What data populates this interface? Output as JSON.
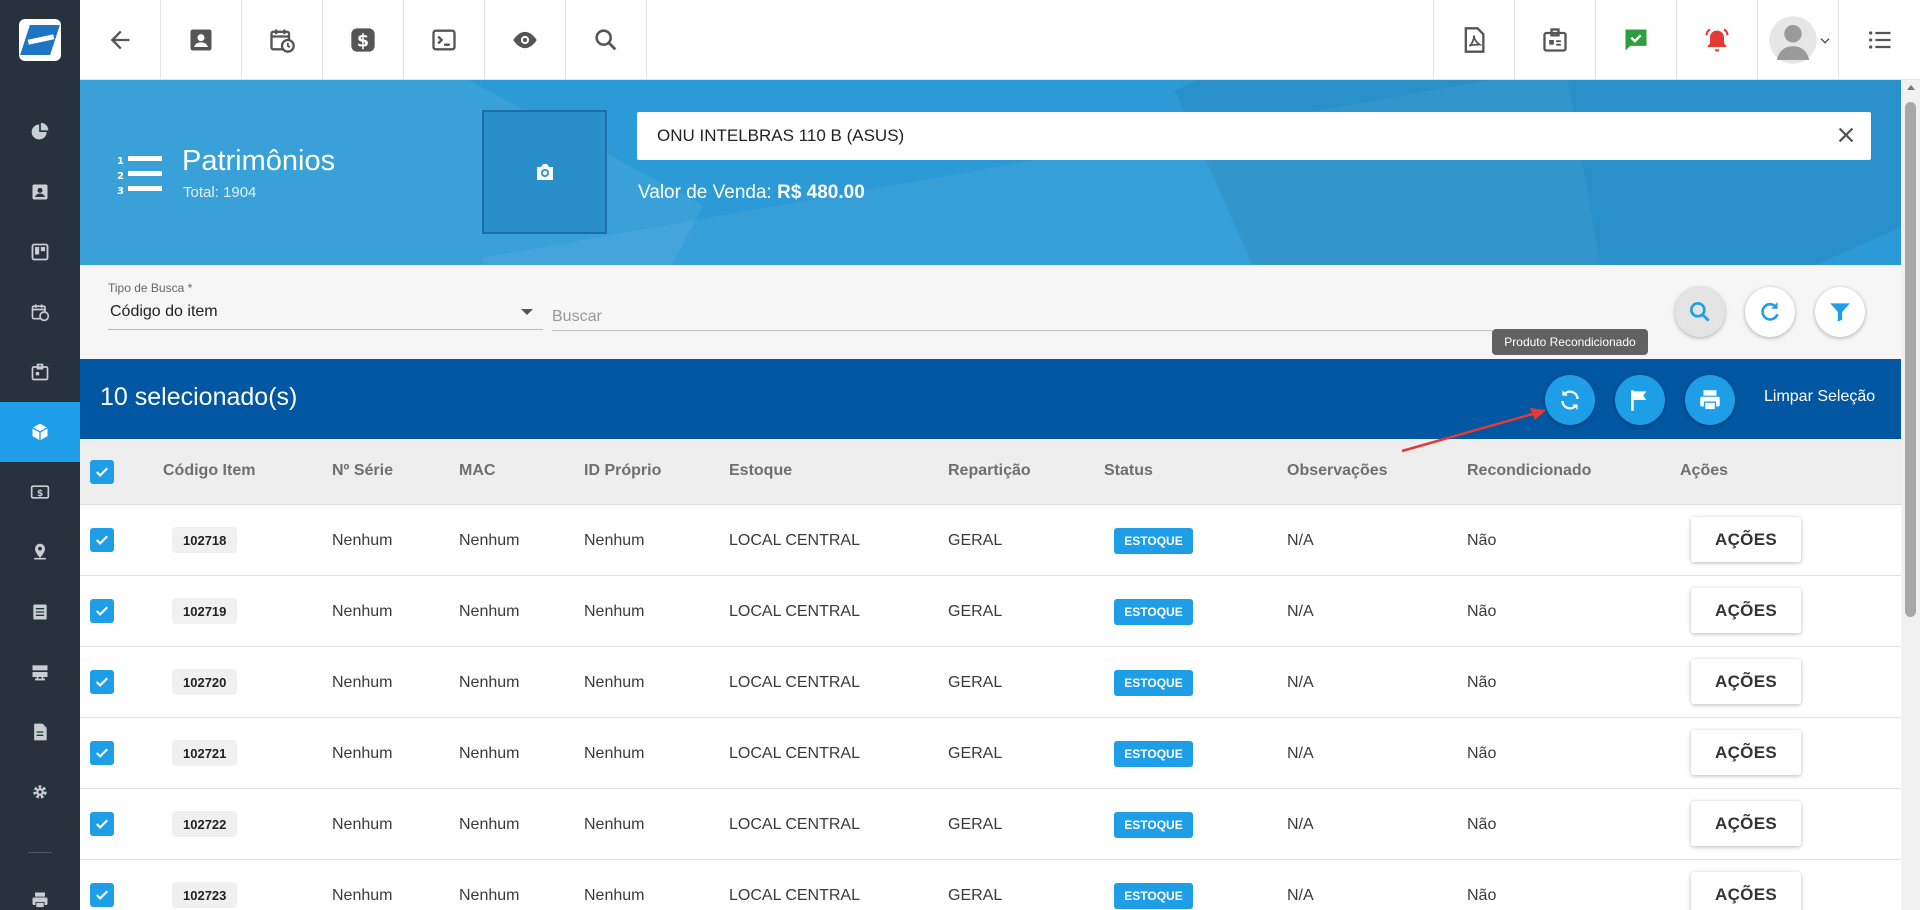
{
  "app": {
    "topbar_icons": [
      "back-arrow-icon",
      "contact-card-icon",
      "calendar-clock-icon",
      "dollar-icon",
      "terminal-icon",
      "eye-icon",
      "search-icon",
      "pdf-icon",
      "badge-icon",
      "message-check-icon",
      "alarm-bell-icon",
      "user-avatar-icon",
      "menu-list-icon"
    ]
  },
  "sidebar": {
    "items": [
      "pie-chart-icon",
      "contact-card-icon",
      "board-icon",
      "calendar-clock-icon",
      "badge-icon",
      "box-icon",
      "money-icon",
      "location-pin-icon",
      "list-icon",
      "server-icon",
      "document-icon",
      "gear-icon",
      "printer-icon"
    ],
    "active_index": 5
  },
  "header": {
    "title": "Patrimônios",
    "subtitle": "Total: 1904",
    "product_name": "ONU INTELBRAS 110 B (ASUS)",
    "sale_label": "Valor de Venda:",
    "sale_value": "R$ 480.00"
  },
  "search": {
    "tipo_label": "Tipo de Busca *",
    "tipo_value": "Código do item",
    "buscar_placeholder": "Buscar"
  },
  "tooltip": "Produto Recondicionado",
  "selection": {
    "count_text": "10 selecionado(s)",
    "clear_label": "Limpar Seleção"
  },
  "table": {
    "columns": [
      "Código Item",
      "Nº Série",
      "MAC",
      "ID Próprio",
      "Estoque",
      "Repartição",
      "Status",
      "Observações",
      "Recondicionado",
      "Ações"
    ],
    "rows": [
      {
        "codigo": "102718",
        "serie": "Nenhum",
        "mac": "Nenhum",
        "id_proprio": "Nenhum",
        "estoque": "LOCAL CENTRAL",
        "reparticao": "GERAL",
        "status": "ESTOQUE",
        "observacoes": "N/A",
        "recondicionado": "Não",
        "acoes": "AÇÕES"
      },
      {
        "codigo": "102719",
        "serie": "Nenhum",
        "mac": "Nenhum",
        "id_proprio": "Nenhum",
        "estoque": "LOCAL CENTRAL",
        "reparticao": "GERAL",
        "status": "ESTOQUE",
        "observacoes": "N/A",
        "recondicionado": "Não",
        "acoes": "AÇÕES"
      },
      {
        "codigo": "102720",
        "serie": "Nenhum",
        "mac": "Nenhum",
        "id_proprio": "Nenhum",
        "estoque": "LOCAL CENTRAL",
        "reparticao": "GERAL",
        "status": "ESTOQUE",
        "observacoes": "N/A",
        "recondicionado": "Não",
        "acoes": "AÇÕES"
      },
      {
        "codigo": "102721",
        "serie": "Nenhum",
        "mac": "Nenhum",
        "id_proprio": "Nenhum",
        "estoque": "LOCAL CENTRAL",
        "reparticao": "GERAL",
        "status": "ESTOQUE",
        "observacoes": "N/A",
        "recondicionado": "Não",
        "acoes": "AÇÕES"
      },
      {
        "codigo": "102722",
        "serie": "Nenhum",
        "mac": "Nenhum",
        "id_proprio": "Nenhum",
        "estoque": "LOCAL CENTRAL",
        "reparticao": "GERAL",
        "status": "ESTOQUE",
        "observacoes": "N/A",
        "recondicionado": "Não",
        "acoes": "AÇÕES"
      },
      {
        "codigo": "102723",
        "serie": "Nenhum",
        "mac": "Nenhum",
        "id_proprio": "Nenhum",
        "estoque": "LOCAL CENTRAL",
        "reparticao": "GERAL",
        "status": "ESTOQUE",
        "observacoes": "N/A",
        "recondicionado": "Não",
        "acoes": "AÇÕES"
      }
    ]
  },
  "colors": {
    "accent": "#1e9ee6",
    "selection_bar": "#0257a3",
    "banner": "#2c9ad6",
    "sidebar": "#27323d",
    "annotation_arrow": "#e53935"
  }
}
